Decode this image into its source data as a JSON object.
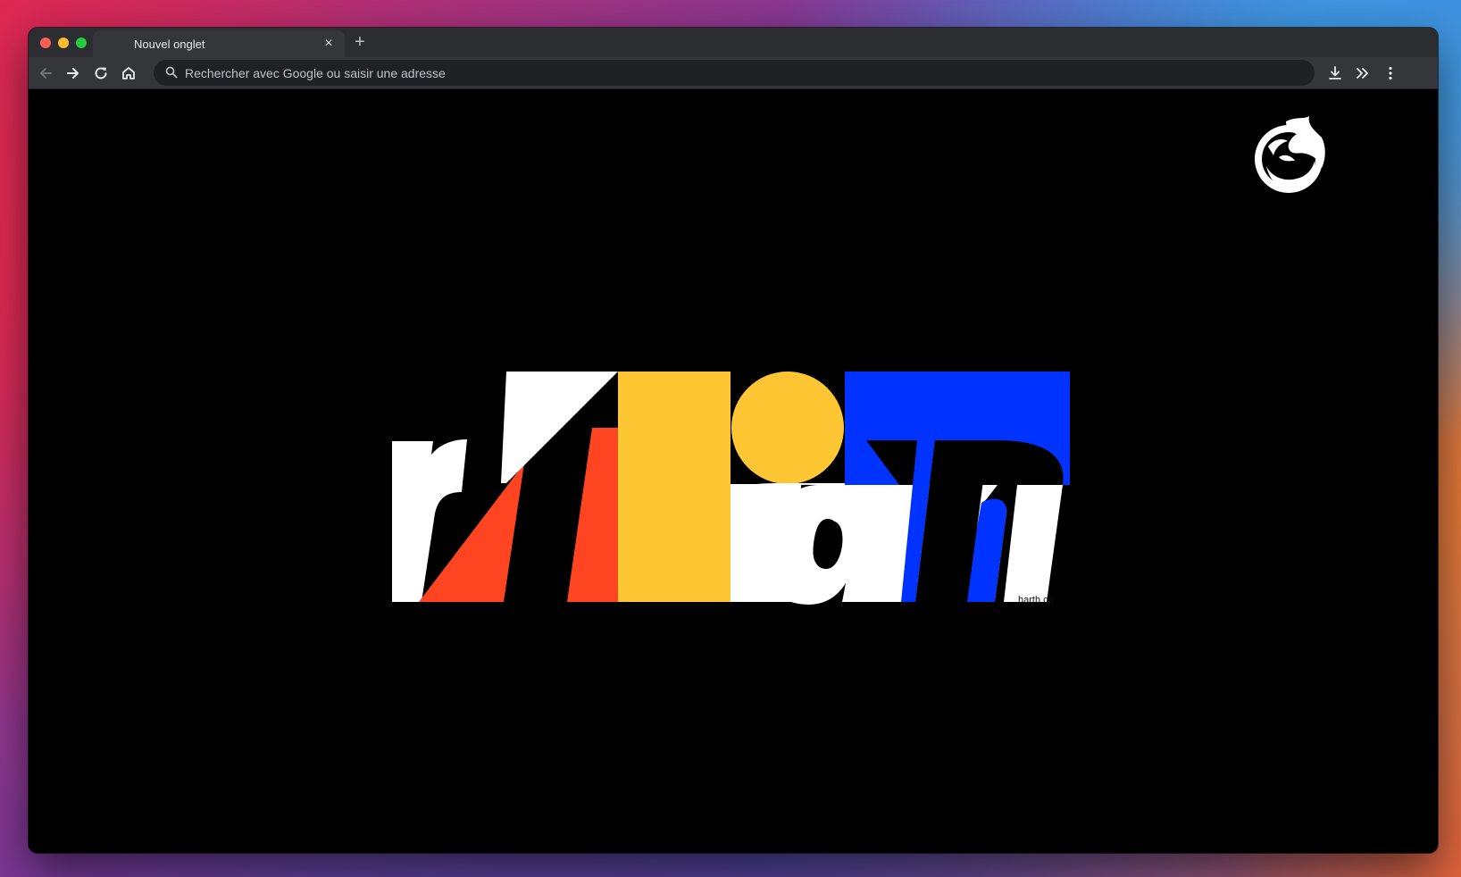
{
  "browser": {
    "tab": {
      "title": "Nouvel onglet",
      "close_glyph": "×"
    },
    "new_tab_glyph": "+",
    "omnibox": {
      "placeholder": "Rechercher avec Google ou saisir une adresse"
    },
    "icons": {
      "back": "arrow-left-icon",
      "forward": "arrow-right-icon",
      "reload": "reload-icon",
      "home": "home-icon",
      "search": "search-icon",
      "download": "download-icon",
      "extensions": "chevron-double-right-icon",
      "menu": "kebab-menu-icon"
    }
  },
  "page": {
    "credit_text": "harth.co",
    "colors": {
      "background": "#000000",
      "white": "#ffffff",
      "red": "#ff4422",
      "yellow": "#ffc634",
      "blue": "#0033ff"
    }
  }
}
